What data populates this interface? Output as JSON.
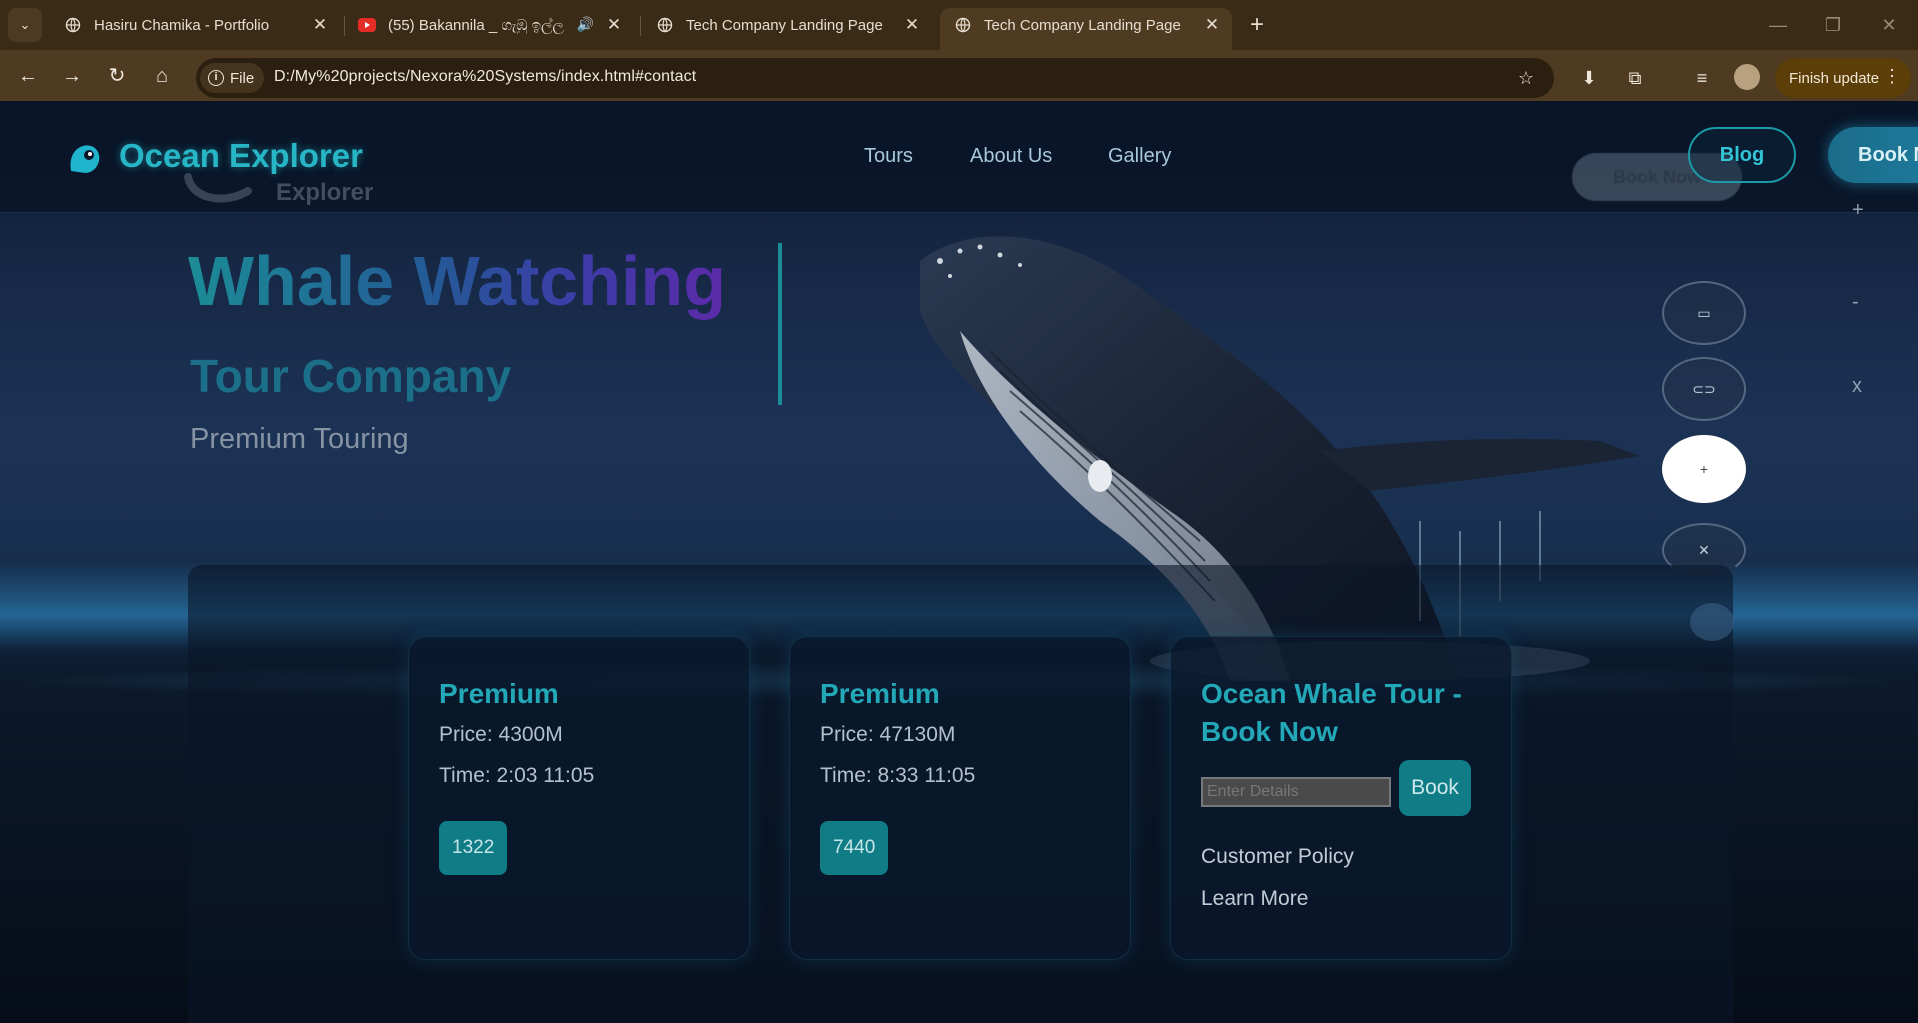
{
  "browser": {
    "tabs": [
      {
        "title": "Hasiru Chamika - Portfolio",
        "icon": "globe-icon"
      },
      {
        "title": "(55) Bakannila _ ගැඹු ඉල්ල",
        "icon": "youtube-icon"
      },
      {
        "title": "Tech Company Landing Page",
        "icon": "globe-icon"
      },
      {
        "title": "Tech Company Landing Page",
        "icon": "globe-icon"
      }
    ],
    "file_label": "File",
    "url": "D:/My%20projects/Nexora%20Systems/index.html#contact",
    "update_label": "Finish update"
  },
  "site": {
    "logo_text": "Ocean Explorer",
    "logo_ghost_text": "Explorer",
    "nav": [
      "Tours",
      "About Us",
      "Gallery"
    ],
    "ghost_button": "Book Now",
    "blog_button": "Blog",
    "book_button": "Book N",
    "hero": {
      "title": "Whale Watching",
      "subtitle": "Tour Company",
      "tagline": "Premium Touring"
    },
    "side_marks": [
      "+",
      "-",
      "x"
    ],
    "cards": [
      {
        "title": "Premium",
        "price": "Price: 4300M",
        "time": "Time: 2:03 11:05",
        "badge": "1322"
      },
      {
        "title": "Premium",
        "price": "Price: 47130M",
        "time": "Time: 8:33 11:05",
        "badge": "7440"
      }
    ],
    "booking": {
      "title": "Ocean Whale Tour - Book Now",
      "placeholder": "Enter Details",
      "button": "Book",
      "links": [
        "Customer Policy",
        "Learn More"
      ]
    }
  },
  "colors": {
    "accent": "#27b6c6",
    "button_teal": "#0f7c86",
    "chrome_bg": "#3a2b17"
  }
}
